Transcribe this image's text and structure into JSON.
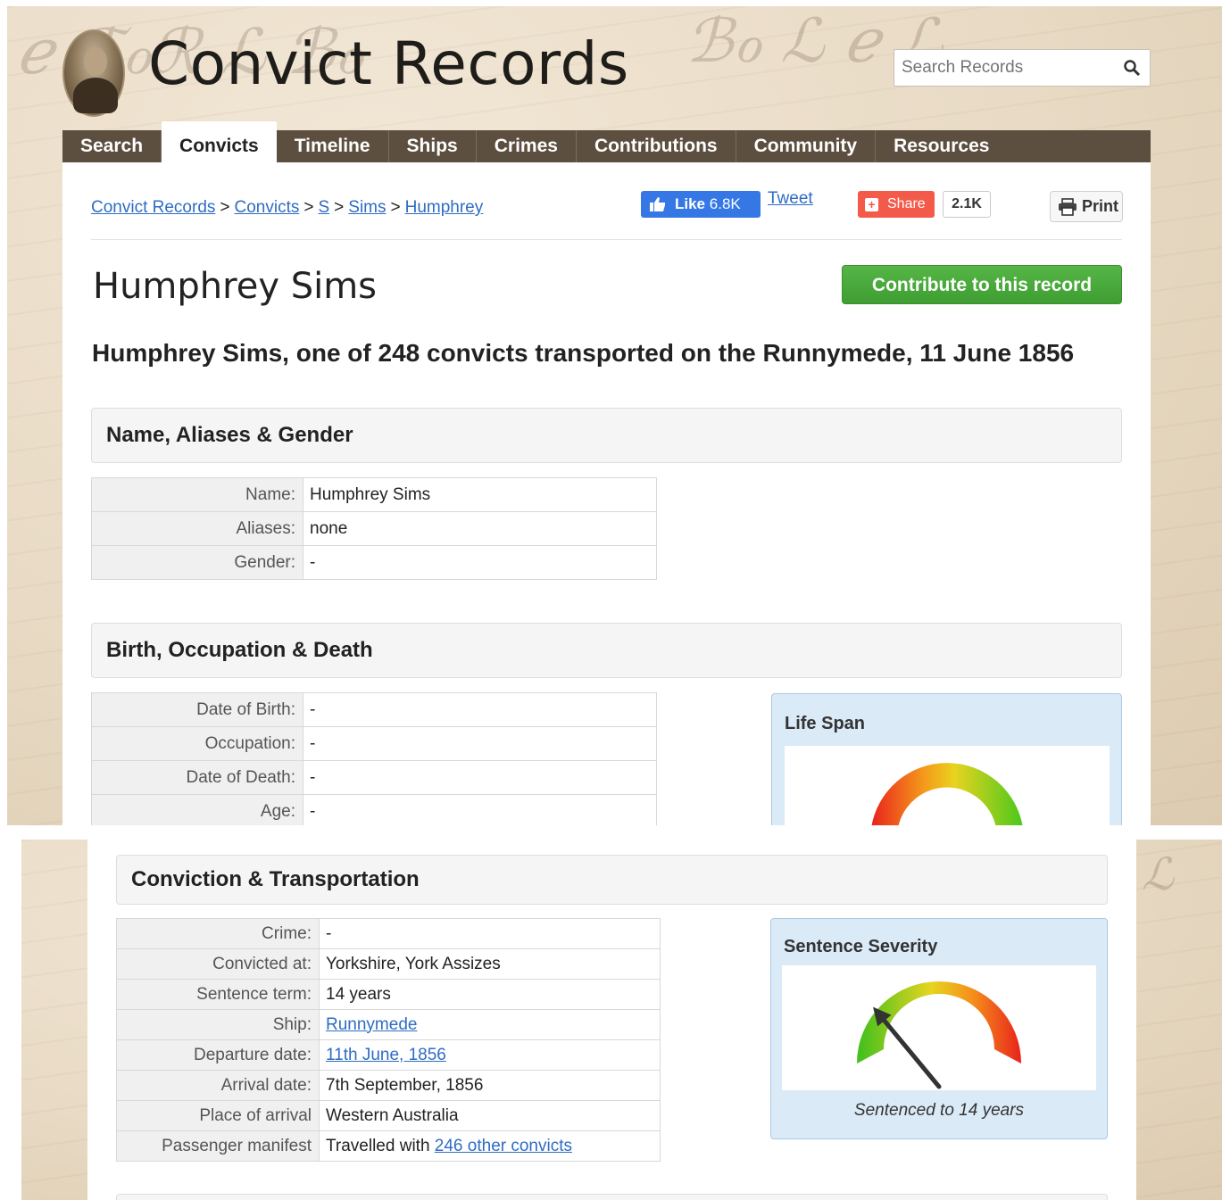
{
  "site": {
    "title": "Convict Records",
    "search_placeholder": "Search Records"
  },
  "nav": {
    "items": [
      "Search",
      "Convicts",
      "Timeline",
      "Ships",
      "Crimes",
      "Contributions",
      "Community",
      "Resources"
    ],
    "active": "Convicts"
  },
  "breadcrumb": [
    "Convict Records",
    "Convicts",
    "S",
    "Sims",
    "Humphrey"
  ],
  "breadcrumb_separator": ">",
  "social": {
    "like_label": "Like",
    "like_count": "6.8K",
    "tweet_label": "Tweet",
    "share_label": "Share",
    "share_count": "2.1K",
    "print_label": "Print"
  },
  "record": {
    "name": "Humphrey Sims",
    "contribute_label": "Contribute to this record",
    "summary": "Humphrey Sims, one of 248 convicts transported on the Runnymede, 11 June 1856"
  },
  "sections": {
    "name_aliases_gender": {
      "title": "Name, Aliases & Gender",
      "rows": [
        {
          "label": "Name:",
          "value": "Humphrey Sims"
        },
        {
          "label": "Aliases:",
          "value": "none"
        },
        {
          "label": "Gender:",
          "value": "-"
        }
      ]
    },
    "birth_occupation_death": {
      "title": "Birth, Occupation & Death",
      "rows": [
        {
          "label": "Date of Birth:",
          "value": "-"
        },
        {
          "label": "Occupation:",
          "value": "-"
        },
        {
          "label": "Date of Death:",
          "value": "-"
        },
        {
          "label": "Age:",
          "value": "-"
        }
      ],
      "widget_title": "Life Span"
    },
    "conviction_transportation": {
      "title": "Conviction & Transportation",
      "rows": [
        {
          "label": "Crime:",
          "value": "-"
        },
        {
          "label": "Convicted at:",
          "value": "Yorkshire, York Assizes"
        },
        {
          "label": "Sentence term:",
          "value": "14 years"
        },
        {
          "label": "Ship:",
          "value": "Runnymede",
          "link": true
        },
        {
          "label": "Departure date:",
          "value": "11th June, 1856",
          "link": true
        },
        {
          "label": "Arrival date:",
          "value": "7th September, 1856"
        },
        {
          "label": "Place of arrival",
          "value": "Western Australia"
        },
        {
          "label": "Passenger manifest",
          "value_prefix": "Travelled with",
          "value_link": "246 other convicts"
        }
      ],
      "widget_title": "Sentence Severity",
      "widget_caption": "Sentenced to 14 years",
      "gauge_level": 0.28
    }
  },
  "colors": {
    "nav_bg": "#5d4f40",
    "link": "#2f6cc4",
    "contribute_green": "#4aaa3c",
    "facebook_blue": "#3578e5",
    "share_red": "#f45a4a",
    "widget_bg": "#dbeaf7"
  },
  "icons": [
    "search-icon",
    "thumbs-up-icon",
    "plus-icon",
    "printer-icon",
    "gauge-needle-icon"
  ]
}
